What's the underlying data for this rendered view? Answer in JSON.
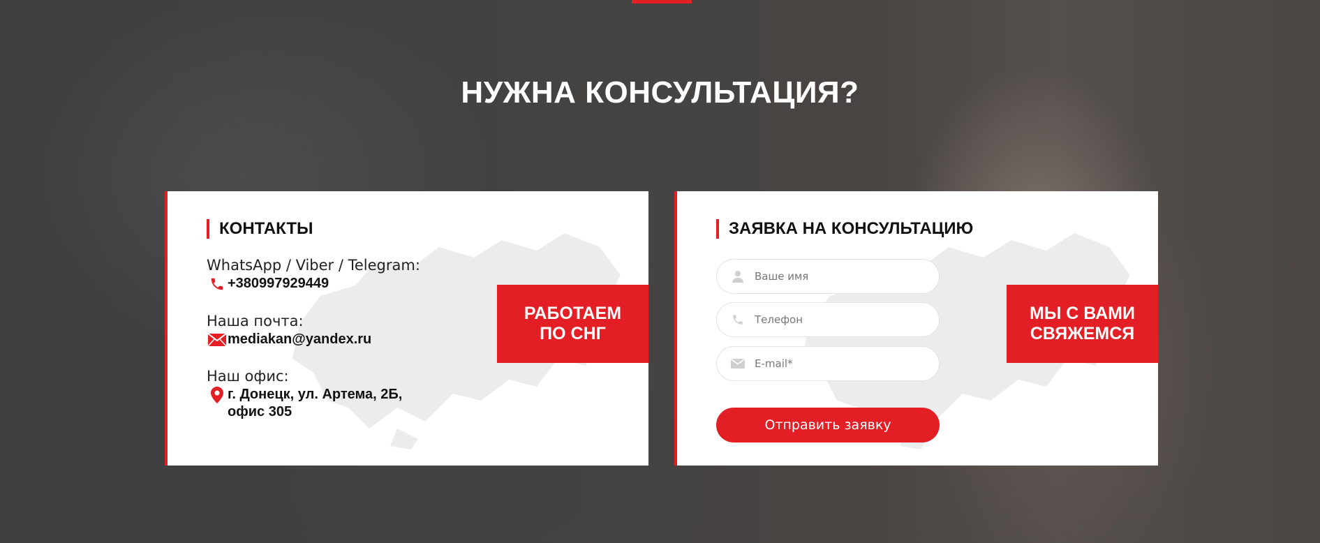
{
  "section": {
    "title": "НУЖНА КОНСУЛЬТАЦИЯ?",
    "accent_color": "#e31e24"
  },
  "contacts": {
    "heading": "КОНТАКТЫ",
    "messengers_label": "WhatsApp / Viber / Telegram:",
    "phone": "+380997929449",
    "phone_icon": "phone-icon",
    "email_label": "Наша почта:",
    "email": "mediakan@yandex.ru",
    "email_icon": "envelope-icon",
    "office_label": "Наш офис:",
    "address": "г. Донецк, ул. Артема, 2Б, офис 305",
    "address_icon": "map-pin-icon",
    "badge": "РАБОТАЕМ\nПО СНГ"
  },
  "form": {
    "heading": "ЗАЯВКА НА КОНСУЛЬТАЦИЮ",
    "name_placeholder": "Ваше имя",
    "name_value": "",
    "phone_placeholder": "Телефон",
    "phone_value": "",
    "email_placeholder": "E-mail*",
    "email_value": "",
    "submit_label": "Отправить заявку",
    "badge": "МЫ С ВАМИ\nСВЯЖЕМСЯ"
  }
}
